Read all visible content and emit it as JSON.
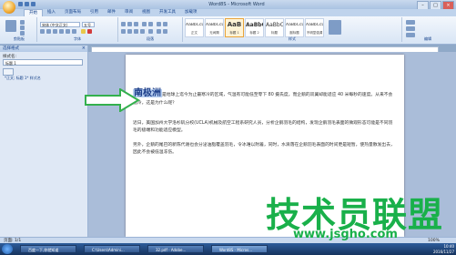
{
  "window": {
    "title": "Word8S - Microsoft Word",
    "controls": [
      "–",
      "□",
      "×"
    ]
  },
  "tabs": [
    {
      "label": "开始",
      "active": true
    },
    {
      "label": "插入",
      "active": false
    },
    {
      "label": "页面布局",
      "active": false
    },
    {
      "label": "引用",
      "active": false
    },
    {
      "label": "邮件",
      "active": false
    },
    {
      "label": "审阅",
      "active": false
    },
    {
      "label": "视图",
      "active": false
    },
    {
      "label": "开发工具",
      "active": false
    },
    {
      "label": "加载项",
      "active": false
    }
  ],
  "ribbon": {
    "font_name": "宋体 (中文正文)",
    "font_size": "五号",
    "groups": [
      "剪贴板",
      "字体",
      "段落",
      "样式",
      "编辑"
    ],
    "styles": [
      {
        "sample": "AaBbCcDc",
        "name": "正文",
        "selected": false
      },
      {
        "sample": "AaBbCcDc",
        "name": "无间隔",
        "selected": false
      },
      {
        "sample": "AaB",
        "name": "标题 1",
        "selected": true
      },
      {
        "sample": "AaBbC",
        "name": "标题 2",
        "selected": false
      },
      {
        "sample": "AaBbC",
        "name": "标题",
        "selected": false
      },
      {
        "sample": "AaBbCcL",
        "name": "副标题",
        "selected": false
      },
      {
        "sample": "AaBbCcDc",
        "name": "不明显强调",
        "selected": false
      }
    ]
  },
  "styles_pane": {
    "title": "选择格式",
    "subtitle": "样式名:",
    "selected_value": "标题 1",
    "item": "*正文; 标题 1* 样式名"
  },
  "document": {
    "heading": "南极洲",
    "para1_rest": "是地球上迄今为止最寒冷的区域，气温有可能低至零下 80 摄氏度，而企鹅的双翼却能适应 40 米每秒的速度。从来不会低冷，这是为什么呢？",
    "para2": "近日，美国加州大学洛杉矶分校(UCLA)机械及航空工程系研究人员，分析企鹅羽毛的结构，发现企鹅羽毛表面的微观形态可能是不同羽毛的极端和功能适应模型。",
    "para3": "另外，企鹅的尾巴的新陈代谢也会分泌油脂覆盖羽毛，令冰难以附着，同时，水滴落在企鹅羽毛表面的时间更是短暂，使热量散发出去，因此不会被低温冻伤。"
  },
  "status": {
    "page_count": "页面: 1/1",
    "zoom_level": "100%"
  },
  "taskbar": {
    "items": [
      {
        "label": "百度一下,你就知道",
        "active": false
      },
      {
        "label": "C:\\Users\\Admini...",
        "active": false
      },
      {
        "label": "32.pdf - Adobe...",
        "active": false
      },
      {
        "label": "Word8S - Micros...",
        "active": true
      }
    ],
    "time": "10:40",
    "date": "2016/11/27"
  },
  "watermark": {
    "main": "技术员联盟",
    "sub": "www.jsgho.com"
  },
  "colors": {
    "heading_highlight": "#b7cff1",
    "arrow_green": "#33b04d",
    "watermark_green": "#19b04a"
  }
}
